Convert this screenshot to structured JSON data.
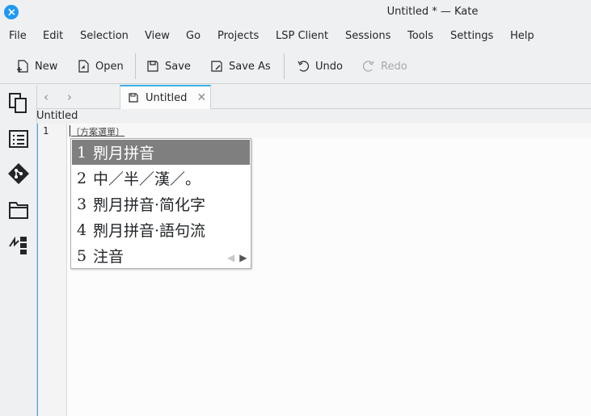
{
  "window": {
    "title": "Untitled * — Kate"
  },
  "menu": [
    "File",
    "Edit",
    "Selection",
    "View",
    "Go",
    "Projects",
    "LSP Client",
    "Sessions",
    "Tools",
    "Settings",
    "Help"
  ],
  "toolbar": {
    "new": "New",
    "open": "Open",
    "save": "Save",
    "save_as": "Save As",
    "undo": "Undo",
    "redo": "Redo"
  },
  "tab": {
    "label": "Untitled"
  },
  "breadcrumb": "Untitled",
  "editor": {
    "line_number": "1",
    "preedit": "〔方案選單〕"
  },
  "candidates": [
    {
      "index": "1",
      "text": "𠝹月拼音",
      "selected": true
    },
    {
      "index": "2",
      "text": "中／半／漢／。",
      "selected": false
    },
    {
      "index": "3",
      "text": "𠝹月拼音·简化字",
      "selected": false
    },
    {
      "index": "4",
      "text": "𠝹月拼音·語句流",
      "selected": false
    },
    {
      "index": "5",
      "text": "注音",
      "selected": false
    }
  ],
  "colors": {
    "accent": "#3daee9",
    "selection": "#7f7f7f"
  }
}
